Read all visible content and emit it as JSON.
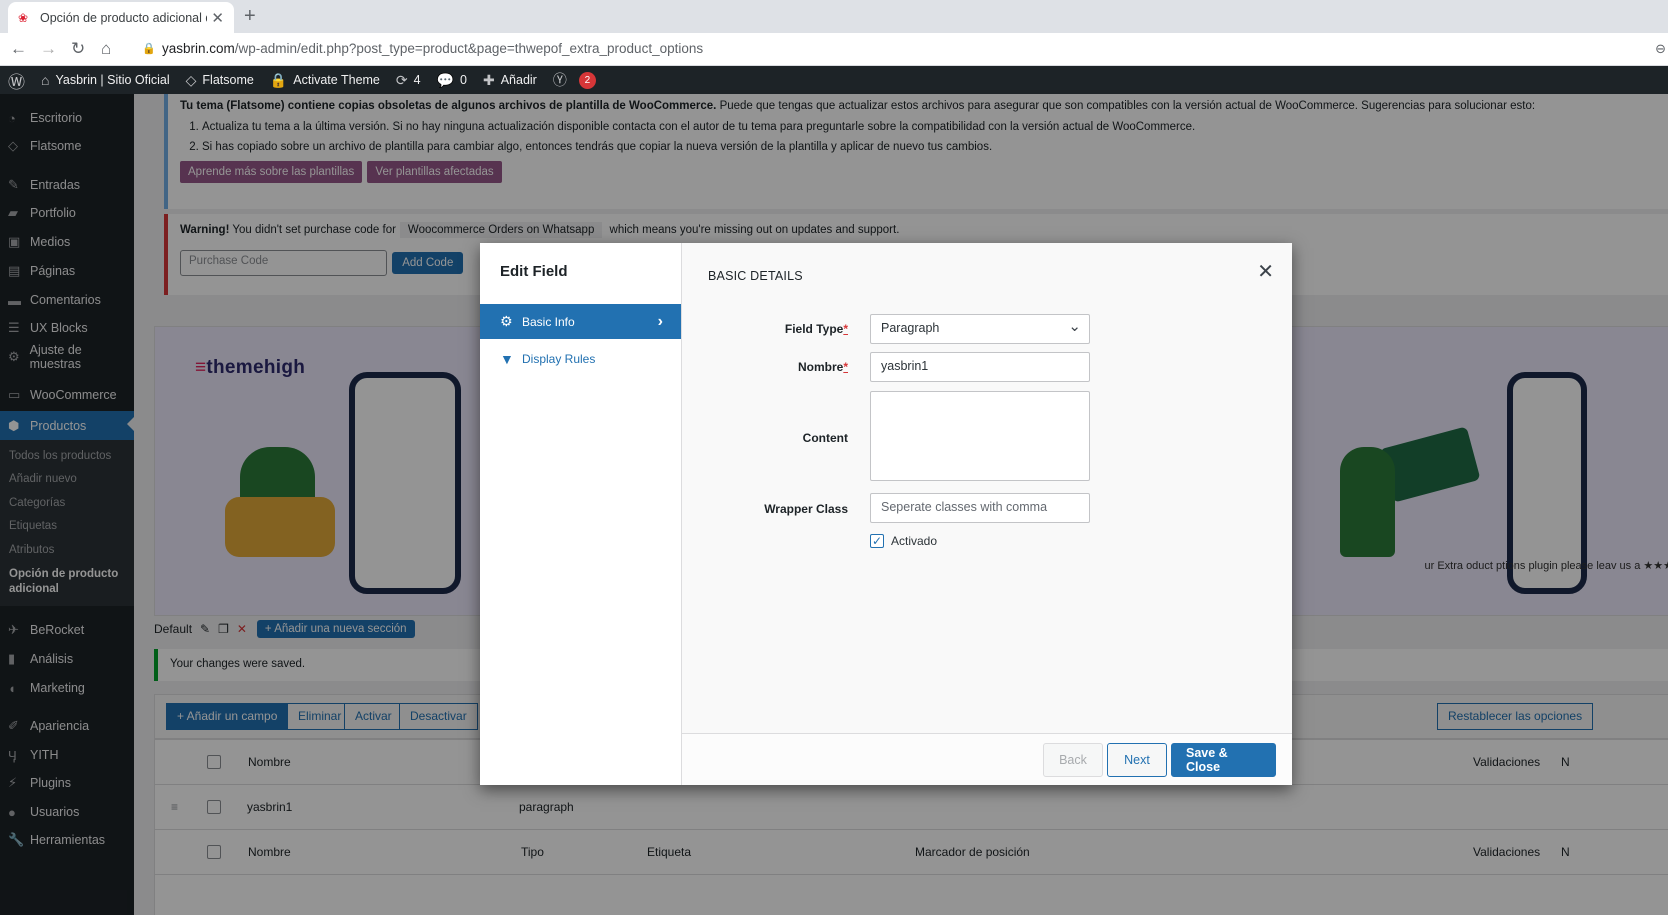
{
  "browser": {
    "tab_title": "Opción de producto adicional de",
    "url_host": "yasbrin.com",
    "url_path": "/wp-admin/edit.php?post_type=product&page=thwepof_extra_product_options"
  },
  "adminbar": {
    "site_name": "Yasbrin | Sitio Oficial",
    "theme": "Flatsome",
    "activate": "Activate Theme",
    "updates": "4",
    "comments": "0",
    "add_new": "Añadir",
    "yoast_count": "2"
  },
  "sidebar": {
    "items": [
      {
        "label": "Escritorio",
        "icon": "dashboard-icon"
      },
      {
        "label": "Flatsome",
        "icon": "flatsome-icon"
      },
      {
        "label": "Entradas",
        "icon": "pin-icon"
      },
      {
        "label": "Portfolio",
        "icon": "folder-icon"
      },
      {
        "label": "Medios",
        "icon": "media-icon"
      },
      {
        "label": "Páginas",
        "icon": "page-icon"
      },
      {
        "label": "Comentarios",
        "icon": "comment-icon"
      },
      {
        "label": "UX Blocks",
        "icon": "blocks-icon"
      },
      {
        "label": "Ajuste de muestras",
        "icon": "settings-icon"
      },
      {
        "label": "WooCommerce",
        "icon": "woo-icon"
      },
      {
        "label": "Productos",
        "icon": "box-icon"
      },
      {
        "label": "BeRocket",
        "icon": "rocket-icon"
      },
      {
        "label": "Análisis",
        "icon": "chart-icon"
      },
      {
        "label": "Marketing",
        "icon": "megaphone-icon"
      },
      {
        "label": "Apariencia",
        "icon": "brush-icon"
      },
      {
        "label": "YITH",
        "icon": "yith-icon"
      },
      {
        "label": "Plugins",
        "icon": "plugin-icon"
      },
      {
        "label": "Usuarios",
        "icon": "user-icon"
      },
      {
        "label": "Herramientas",
        "icon": "tools-icon"
      }
    ],
    "submenu": [
      "Todos los productos",
      "Añadir nuevo",
      "Categorías",
      "Etiquetas",
      "Atributos",
      "Opción de producto adicional"
    ]
  },
  "notices": {
    "outdated_bold": "Tu tema (Flatsome) contiene copias obsoletas de algunos archivos de plantilla de WooCommerce.",
    "outdated_rest": " Puede que tengas que actualizar estos archivos para asegurar que son compatibles con la versión actual de WooCommerce. Sugerencias para solucionar esto:",
    "step1": "Actualiza tu tema a la última versión. Si no hay ninguna actualización disponible contacta con el autor de tu tema para preguntarle sobre la compatibilidad con la versión actual de WooCommerce.",
    "step2": "Si has copiado sobre un archivo de plantilla para cambiar algo, entonces tendrás que copiar la nueva versión de la plantilla y aplicar de nuevo tus cambios.",
    "btn_learn": "Aprende más sobre las plantillas",
    "btn_view": "Ver plantillas afectadas",
    "warning_bold": "Warning!",
    "warning_text": " You didn't set purchase code for",
    "warning_plugin": "Woocommerce Orders on Whatsapp",
    "warning_tail": " which means you're missing out on updates and support.",
    "purchase_placeholder": "Purchase Code",
    "add_code": "Add Code"
  },
  "banner": {
    "brand": "themehigh",
    "text": "ur Extra oduct ptions plugin please leav us a ★★★"
  },
  "section": {
    "name": "Default",
    "add_section": "+ Añadir una nueva sección"
  },
  "saved": "Your changes were saved.",
  "field_toolbar": {
    "add": "+ Añadir un campo",
    "delete": "Eliminar",
    "activate": "Activar",
    "deactivate": "Desactivar",
    "reset": "Restablecer las opciones"
  },
  "table": {
    "head": {
      "name": "Nombre",
      "validations": "Validaciones",
      "n": "N"
    },
    "row": {
      "name": "yasbrin1",
      "type": "paragraph"
    },
    "foot": {
      "name": "Nombre",
      "type": "Tipo",
      "label": "Etiqueta",
      "placeholder": "Marcador de posición",
      "validations": "Validaciones",
      "n": "N"
    }
  },
  "modal": {
    "title": "Edit Field",
    "tabs": [
      {
        "label": "Basic Info",
        "icon": "gear-icon",
        "active": true
      },
      {
        "label": "Display Rules",
        "icon": "filter-icon",
        "active": false
      }
    ],
    "section_title": "BASIC DETAILS",
    "fields": {
      "field_type_label": "Field Type",
      "field_type_value": "Paragraph",
      "name_label": "Nombre",
      "name_value": "yasbrin1",
      "content_label": "Content",
      "content_value": "",
      "wrapper_label": "Wrapper Class",
      "wrapper_placeholder": "Seperate classes with comma",
      "enabled_label": "Activado",
      "enabled": true
    },
    "buttons": {
      "back": "Back",
      "next": "Next",
      "save": "Save & Close"
    }
  }
}
